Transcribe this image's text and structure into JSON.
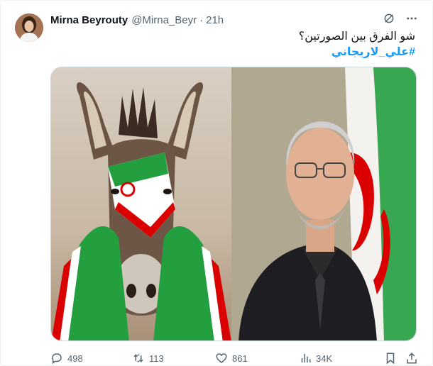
{
  "tweet": {
    "author_name": "Mirna Beyrouty",
    "handle": "@Mirna_Beyr",
    "separator": "·",
    "time": "21h",
    "text": "شو الفرق بين الصورتين؟",
    "hashtag": "#علي_لاريجاني",
    "images": [
      {
        "subject": "donkey wrapped in Iranian flag colors"
      },
      {
        "subject": "gray-haired man in glasses in front of Iranian flag"
      }
    ]
  },
  "actions": {
    "replies": "498",
    "retweets": "113",
    "likes": "861",
    "views": "34K"
  },
  "icons": {
    "grok": "grok-icon",
    "more": "more-icon",
    "reply": "reply-icon",
    "retweet": "retweet-icon",
    "like": "heart-icon",
    "views": "views-icon",
    "bookmark": "bookmark-icon",
    "share": "share-icon"
  },
  "colors": {
    "hashtag": "#1d9bf0",
    "secondary_text": "#536471",
    "flag_green": "#239f40",
    "flag_red": "#da0000"
  }
}
